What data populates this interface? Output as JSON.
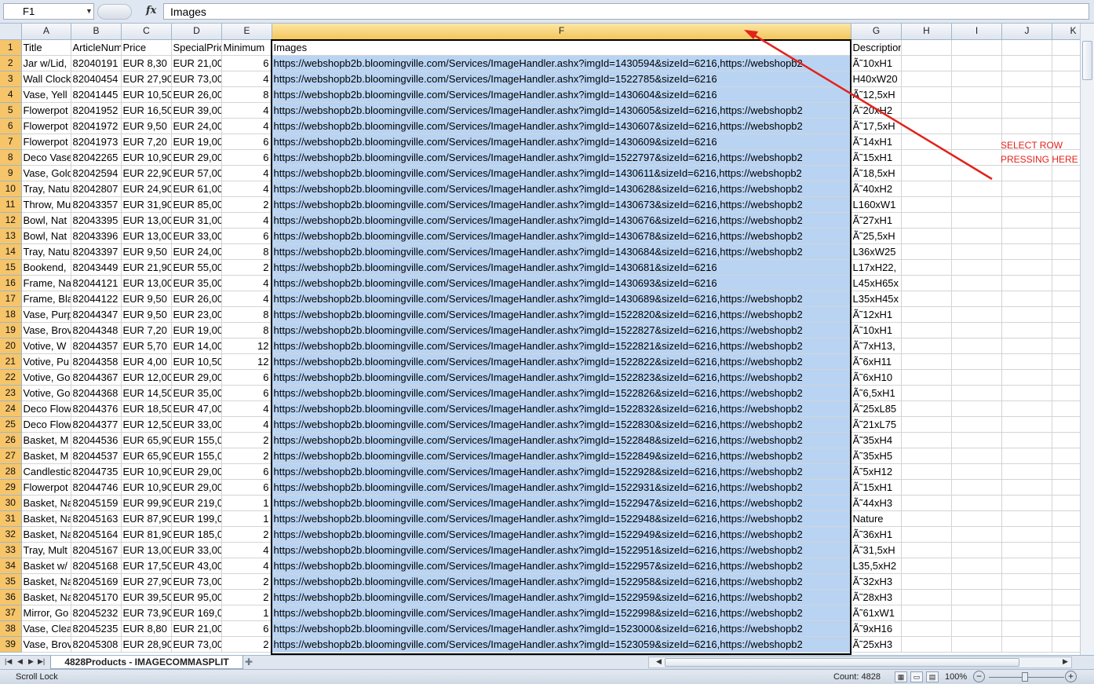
{
  "formula_bar": {
    "name_box": "F1",
    "fx": "fx",
    "content": "Images"
  },
  "columns": [
    "A",
    "B",
    "C",
    "D",
    "E",
    "F",
    "G",
    "H",
    "I",
    "J",
    "K"
  ],
  "selected_column": "F",
  "header_row": {
    "row": "1",
    "A": "Title",
    "B": "ArticleNumber",
    "C": "Price",
    "D": "SpecialPrice",
    "E": "Minimum",
    "F": "Images",
    "G": "Description"
  },
  "rows": [
    {
      "row": "2",
      "title": "Jar w/Lid,",
      "article": "82040191",
      "price": "EUR 8,30",
      "special": "EUR 21,00",
      "min": "6",
      "images": "https://webshopb2b.bloomingville.com/Services/ImageHandler.ashx?imgId=1430594&sizeId=6216,https://webshopb2",
      "desc": "Ã˜10xH1"
    },
    {
      "row": "3",
      "title": "Wall Clock",
      "article": "82040454",
      "price": "EUR 27,90",
      "special": "EUR 73,00",
      "min": "4",
      "images": "https://webshopb2b.bloomingville.com/Services/ImageHandler.ashx?imgId=1522785&sizeId=6216",
      "desc": "H40xW20"
    },
    {
      "row": "4",
      "title": "Vase, Yell",
      "article": "82041445",
      "price": "EUR 10,50",
      "special": "EUR 26,00",
      "min": "8",
      "images": "https://webshopb2b.bloomingville.com/Services/ImageHandler.ashx?imgId=1430604&sizeId=6216",
      "desc": "Ã˜12,5xH"
    },
    {
      "row": "5",
      "title": "Flowerpot",
      "article": "82041952",
      "price": "EUR 16,50",
      "special": "EUR 39,00",
      "min": "4",
      "images": "https://webshopb2b.bloomingville.com/Services/ImageHandler.ashx?imgId=1430605&sizeId=6216,https://webshopb2",
      "desc": "Ã˜20xH2"
    },
    {
      "row": "6",
      "title": "Flowerpot",
      "article": "82041972",
      "price": "EUR 9,50",
      "special": "EUR 24,00",
      "min": "4",
      "images": "https://webshopb2b.bloomingville.com/Services/ImageHandler.ashx?imgId=1430607&sizeId=6216,https://webshopb2",
      "desc": "Ã˜17,5xH"
    },
    {
      "row": "7",
      "title": "Flowerpot",
      "article": "82041973",
      "price": "EUR 7,20",
      "special": "EUR 19,00",
      "min": "6",
      "images": "https://webshopb2b.bloomingville.com/Services/ImageHandler.ashx?imgId=1430609&sizeId=6216",
      "desc": "Ã˜14xH1"
    },
    {
      "row": "8",
      "title": "Deco Vase",
      "article": "82042265",
      "price": "EUR 10,90",
      "special": "EUR 29,00",
      "min": "6",
      "images": "https://webshopb2b.bloomingville.com/Services/ImageHandler.ashx?imgId=1522797&sizeId=6216,https://webshopb2",
      "desc": "Ã˜15xH1"
    },
    {
      "row": "9",
      "title": "Vase, Gold",
      "article": "82042594",
      "price": "EUR 22,90",
      "special": "EUR 57,00",
      "min": "4",
      "images": "https://webshopb2b.bloomingville.com/Services/ImageHandler.ashx?imgId=1430611&sizeId=6216,https://webshopb2",
      "desc": "Ã˜18,5xH"
    },
    {
      "row": "10",
      "title": "Tray, Natu",
      "article": "82042807",
      "price": "EUR 24,90",
      "special": "EUR 61,00",
      "min": "4",
      "images": "https://webshopb2b.bloomingville.com/Services/ImageHandler.ashx?imgId=1430628&sizeId=6216,https://webshopb2",
      "desc": "Ã˜40xH2"
    },
    {
      "row": "11",
      "title": "Throw, Mu",
      "article": "82043357",
      "price": "EUR 31,90",
      "special": "EUR 85,00",
      "min": "2",
      "images": "https://webshopb2b.bloomingville.com/Services/ImageHandler.ashx?imgId=1430673&sizeId=6216,https://webshopb2",
      "desc": "L160xW1"
    },
    {
      "row": "12",
      "title": "Bowl, Nat",
      "article": "82043395",
      "price": "EUR 13,00",
      "special": "EUR 31,00",
      "min": "4",
      "images": "https://webshopb2b.bloomingville.com/Services/ImageHandler.ashx?imgId=1430676&sizeId=6216,https://webshopb2",
      "desc": "Ã˜27xH1"
    },
    {
      "row": "13",
      "title": "Bowl, Nat",
      "article": "82043396",
      "price": "EUR 13,00",
      "special": "EUR 33,00",
      "min": "6",
      "images": "https://webshopb2b.bloomingville.com/Services/ImageHandler.ashx?imgId=1430678&sizeId=6216,https://webshopb2",
      "desc": "Ã˜25,5xH"
    },
    {
      "row": "14",
      "title": "Tray, Natu",
      "article": "82043397",
      "price": "EUR 9,50",
      "special": "EUR 24,00",
      "min": "8",
      "images": "https://webshopb2b.bloomingville.com/Services/ImageHandler.ashx?imgId=1430684&sizeId=6216,https://webshopb2",
      "desc": "L36xW25"
    },
    {
      "row": "15",
      "title": "Bookend,",
      "article": "82043449",
      "price": "EUR 21,90",
      "special": "EUR 55,00",
      "min": "2",
      "images": "https://webshopb2b.bloomingville.com/Services/ImageHandler.ashx?imgId=1430681&sizeId=6216",
      "desc": "L17xH22,"
    },
    {
      "row": "16",
      "title": "Frame, Na",
      "article": "82044121",
      "price": "EUR 13,00",
      "special": "EUR 35,00",
      "min": "4",
      "images": "https://webshopb2b.bloomingville.com/Services/ImageHandler.ashx?imgId=1430693&sizeId=6216",
      "desc": "L45xH65x"
    },
    {
      "row": "17",
      "title": "Frame, Bla",
      "article": "82044122",
      "price": "EUR 9,50",
      "special": "EUR 26,00",
      "min": "4",
      "images": "https://webshopb2b.bloomingville.com/Services/ImageHandler.ashx?imgId=1430689&sizeId=6216,https://webshopb2",
      "desc": "L35xH45x"
    },
    {
      "row": "18",
      "title": "Vase, Purp",
      "article": "82044347",
      "price": "EUR 9,50",
      "special": "EUR 23,00",
      "min": "8",
      "images": "https://webshopb2b.bloomingville.com/Services/ImageHandler.ashx?imgId=1522820&sizeId=6216,https://webshopb2",
      "desc": "Ã˜12xH1"
    },
    {
      "row": "19",
      "title": "Vase, Brov",
      "article": "82044348",
      "price": "EUR 7,20",
      "special": "EUR 19,00",
      "min": "8",
      "images": "https://webshopb2b.bloomingville.com/Services/ImageHandler.ashx?imgId=1522827&sizeId=6216,https://webshopb2",
      "desc": "Ã˜10xH1"
    },
    {
      "row": "20",
      "title": "Votive, W",
      "article": "82044357",
      "price": "EUR 5,70",
      "special": "EUR 14,00",
      "min": "12",
      "images": "https://webshopb2b.bloomingville.com/Services/ImageHandler.ashx?imgId=1522821&sizeId=6216,https://webshopb2",
      "desc": "Ã˜7xH13,"
    },
    {
      "row": "21",
      "title": "Votive, Pu",
      "article": "82044358",
      "price": "EUR 4,00",
      "special": "EUR 10,50",
      "min": "12",
      "images": "https://webshopb2b.bloomingville.com/Services/ImageHandler.ashx?imgId=1522822&sizeId=6216,https://webshopb2",
      "desc": "Ã˜6xH11"
    },
    {
      "row": "22",
      "title": "Votive, Go",
      "article": "82044367",
      "price": "EUR 12,00",
      "special": "EUR 29,00",
      "min": "6",
      "images": "https://webshopb2b.bloomingville.com/Services/ImageHandler.ashx?imgId=1522823&sizeId=6216,https://webshopb2",
      "desc": "Ã˜6xH10"
    },
    {
      "row": "23",
      "title": "Votive, Go",
      "article": "82044368",
      "price": "EUR 14,50",
      "special": "EUR 35,00",
      "min": "6",
      "images": "https://webshopb2b.bloomingville.com/Services/ImageHandler.ashx?imgId=1522826&sizeId=6216,https://webshopb2",
      "desc": "Ã˜6,5xH1"
    },
    {
      "row": "24",
      "title": "Deco Flow",
      "article": "82044376",
      "price": "EUR 18,50",
      "special": "EUR 47,00",
      "min": "4",
      "images": "https://webshopb2b.bloomingville.com/Services/ImageHandler.ashx?imgId=1522832&sizeId=6216,https://webshopb2",
      "desc": "Ã˜25xL85"
    },
    {
      "row": "25",
      "title": "Deco Flow",
      "article": "82044377",
      "price": "EUR 12,50",
      "special": "EUR 33,00",
      "min": "4",
      "images": "https://webshopb2b.bloomingville.com/Services/ImageHandler.ashx?imgId=1522830&sizeId=6216,https://webshopb2",
      "desc": "Ã˜21xL75"
    },
    {
      "row": "26",
      "title": "Basket, M",
      "article": "82044536",
      "price": "EUR 65,90",
      "special": "EUR 155,00",
      "min": "2",
      "images": "https://webshopb2b.bloomingville.com/Services/ImageHandler.ashx?imgId=1522848&sizeId=6216,https://webshopb2",
      "desc": "Ã˜35xH4"
    },
    {
      "row": "27",
      "title": "Basket, M",
      "article": "82044537",
      "price": "EUR 65,90",
      "special": "EUR 155,00",
      "min": "2",
      "images": "https://webshopb2b.bloomingville.com/Services/ImageHandler.ashx?imgId=1522849&sizeId=6216,https://webshopb2",
      "desc": "Ã˜35xH5"
    },
    {
      "row": "28",
      "title": "Candlestic",
      "article": "82044735",
      "price": "EUR 10,90",
      "special": "EUR 29,00",
      "min": "6",
      "images": "https://webshopb2b.bloomingville.com/Services/ImageHandler.ashx?imgId=1522928&sizeId=6216,https://webshopb2",
      "desc": "Ã˜5xH12"
    },
    {
      "row": "29",
      "title": "Flowerpot",
      "article": "82044746",
      "price": "EUR 10,90",
      "special": "EUR 29,00",
      "min": "6",
      "images": "https://webshopb2b.bloomingville.com/Services/ImageHandler.ashx?imgId=1522931&sizeId=6216,https://webshopb2",
      "desc": "Ã˜15xH1"
    },
    {
      "row": "30",
      "title": "Basket, Na",
      "article": "82045159",
      "price": "EUR 99,90",
      "special": "EUR 219,00",
      "min": "1",
      "images": "https://webshopb2b.bloomingville.com/Services/ImageHandler.ashx?imgId=1522947&sizeId=6216,https://webshopb2",
      "desc": "Ã˜44xH3"
    },
    {
      "row": "31",
      "title": "Basket, Na",
      "article": "82045163",
      "price": "EUR 87,90",
      "special": "EUR 199,00",
      "min": "1",
      "images": "https://webshopb2b.bloomingville.com/Services/ImageHandler.ashx?imgId=1522948&sizeId=6216,https://webshopb2",
      "desc": "Nature"
    },
    {
      "row": "32",
      "title": "Basket, Na",
      "article": "82045164",
      "price": "EUR 81,90",
      "special": "EUR 185,00",
      "min": "2",
      "images": "https://webshopb2b.bloomingville.com/Services/ImageHandler.ashx?imgId=1522949&sizeId=6216,https://webshopb2",
      "desc": "Ã˜36xH1"
    },
    {
      "row": "33",
      "title": "Tray, Mult",
      "article": "82045167",
      "price": "EUR 13,00",
      "special": "EUR 33,00",
      "min": "4",
      "images": "https://webshopb2b.bloomingville.com/Services/ImageHandler.ashx?imgId=1522951&sizeId=6216,https://webshopb2",
      "desc": "Ã˜31,5xH"
    },
    {
      "row": "34",
      "title": "Basket w/",
      "article": "82045168",
      "price": "EUR 17,50",
      "special": "EUR 43,00",
      "min": "4",
      "images": "https://webshopb2b.bloomingville.com/Services/ImageHandler.ashx?imgId=1522957&sizeId=6216,https://webshopb2",
      "desc": "L35,5xH2"
    },
    {
      "row": "35",
      "title": "Basket, Na",
      "article": "82045169",
      "price": "EUR 27,90",
      "special": "EUR 73,00",
      "min": "2",
      "images": "https://webshopb2b.bloomingville.com/Services/ImageHandler.ashx?imgId=1522958&sizeId=6216,https://webshopb2",
      "desc": "Ã˜32xH3"
    },
    {
      "row": "36",
      "title": "Basket, Na",
      "article": "82045170",
      "price": "EUR 39,50",
      "special": "EUR 95,00",
      "min": "2",
      "images": "https://webshopb2b.bloomingville.com/Services/ImageHandler.ashx?imgId=1522959&sizeId=6216,https://webshopb2",
      "desc": "Ã˜28xH3"
    },
    {
      "row": "37",
      "title": "Mirror, Go",
      "article": "82045232",
      "price": "EUR 73,90",
      "special": "EUR 169,00",
      "min": "1",
      "images": "https://webshopb2b.bloomingville.com/Services/ImageHandler.ashx?imgId=1522998&sizeId=6216,https://webshopb2",
      "desc": "Ã˜61xW1"
    },
    {
      "row": "38",
      "title": "Vase, Clea",
      "article": "82045235",
      "price": "EUR 8,80",
      "special": "EUR 21,00",
      "min": "6",
      "images": "https://webshopb2b.bloomingville.com/Services/ImageHandler.ashx?imgId=1523000&sizeId=6216,https://webshopb2",
      "desc": "Ã˜9xH16"
    },
    {
      "row": "39",
      "title": "Vase, Brov",
      "article": "82045308",
      "price": "EUR 28,90",
      "special": "EUR 73,00",
      "min": "2",
      "images": "https://webshopb2b.bloomingville.com/Services/ImageHandler.ashx?imgId=1523059&sizeId=6216,https://webshopb2",
      "desc": "Ã˜25xH3"
    }
  ],
  "annotation": {
    "text_line1": "SELECT ROW",
    "text_line2": "PRESSING HERE",
    "color": "#e2221c"
  },
  "sheet_tabs": {
    "active": "4828Products - IMAGECOMMASPLIT"
  },
  "status_bar": {
    "mode": "Scroll Lock",
    "count": "Count: 4828",
    "zoom": "100%"
  },
  "colors": {
    "selection_fill": "#b9d4f3",
    "row_header_selected": "#f6c56a",
    "annotation": "#e2221c"
  }
}
